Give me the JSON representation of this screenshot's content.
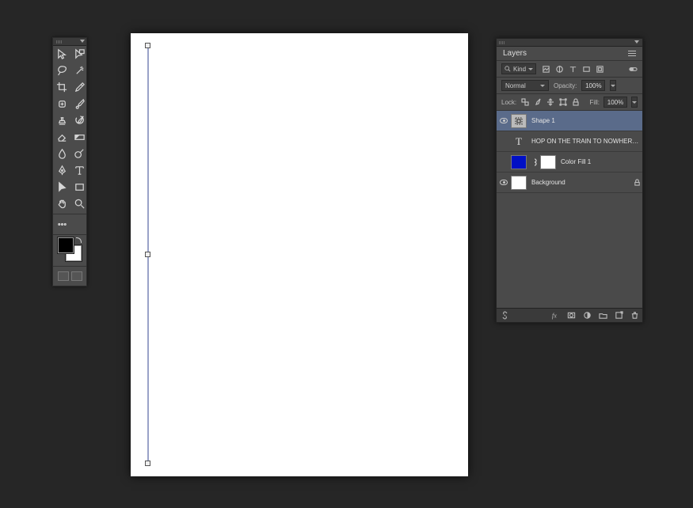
{
  "app": "Adobe Photoshop",
  "tools": {
    "items": [
      {
        "name": "move-tool"
      },
      {
        "name": "artboard-tool"
      },
      {
        "name": "lasso-tool"
      },
      {
        "name": "magic-wand-tool"
      },
      {
        "name": "crop-tool"
      },
      {
        "name": "eyedropper-tool"
      },
      {
        "name": "healing-brush-tool"
      },
      {
        "name": "brush-tool"
      },
      {
        "name": "clone-stamp-tool"
      },
      {
        "name": "history-brush-tool"
      },
      {
        "name": "eraser-tool"
      },
      {
        "name": "gradient-tool"
      },
      {
        "name": "blur-tool"
      },
      {
        "name": "dodge-tool"
      },
      {
        "name": "pen-tool"
      },
      {
        "name": "type-tool"
      },
      {
        "name": "path-selection-tool"
      },
      {
        "name": "rectangle-shape-tool"
      },
      {
        "name": "hand-tool"
      },
      {
        "name": "zoom-tool"
      }
    ],
    "foreground_color": "#000000",
    "background_color": "#ffffff"
  },
  "canvas": {
    "background_color": "#ffffff",
    "shape_path_color": "#9aa2c8"
  },
  "layers_panel": {
    "title": "Layers",
    "filter": {
      "kind_label": "Kind"
    },
    "blend": {
      "mode": "Normal",
      "opacity_label": "Opacity:",
      "opacity_value": "100%"
    },
    "lock": {
      "label": "Lock:",
      "fill_label": "Fill:",
      "fill_value": "100%"
    },
    "layers": [
      {
        "name": "Shape 1",
        "type": "shape",
        "visible": true,
        "selected": true
      },
      {
        "name": "HOP ON THE TRAIN TO NOWHERE BABY",
        "type": "text",
        "visible": false,
        "selected": false
      },
      {
        "name": "Color Fill 1",
        "type": "colorfill",
        "visible": false,
        "selected": false,
        "fill_color": "#0010c5"
      },
      {
        "name": "Background",
        "type": "background",
        "visible": true,
        "selected": false,
        "locked": true
      }
    ]
  }
}
